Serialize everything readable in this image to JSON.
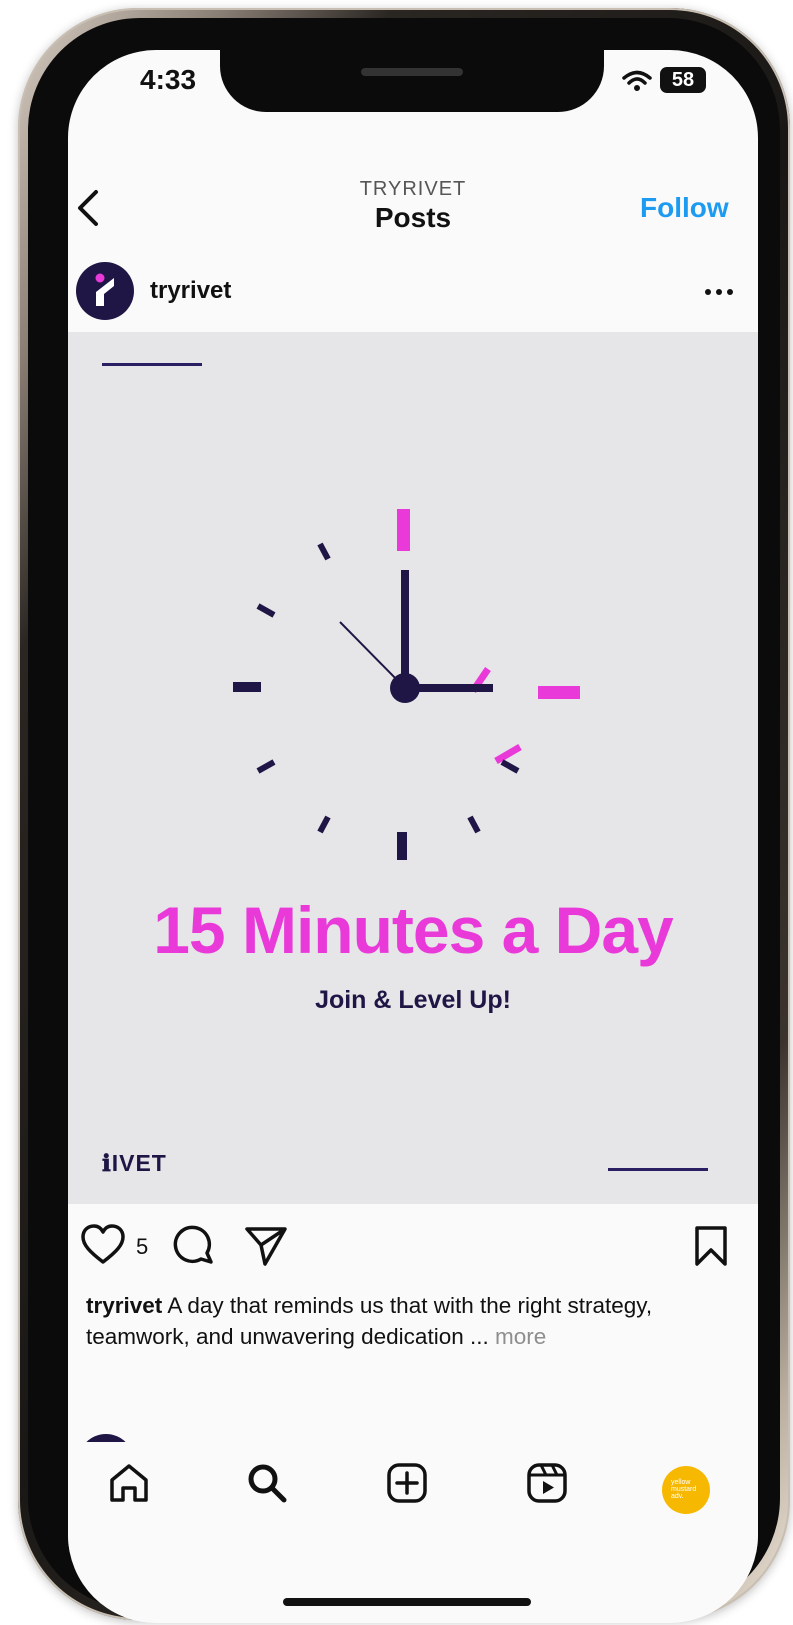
{
  "status": {
    "time": "4:33",
    "battery": "58"
  },
  "header": {
    "account": "TRYRIVET",
    "title": "Posts",
    "follow_label": "Follow"
  },
  "post": {
    "username": "tryrivet",
    "headline": "15 Minutes a Day",
    "subheadline": "Join & Level Up!",
    "brand": "ℹIVET",
    "likes": "5",
    "caption_user": "tryrivet",
    "caption_text": "A day that reminds us that with the right strategy, teamwork, and unwavering dedication ...",
    "caption_more": "more"
  },
  "tabbar": {
    "items": [
      "home-icon",
      "search-icon",
      "create-post-icon",
      "reels-icon",
      "profile-avatar"
    ],
    "profile_text": "yellow mustard adv."
  },
  "colors": {
    "accent_pink": "#e93ad9",
    "navy": "#1f1646",
    "link_blue": "#1d9bf0",
    "image_bg": "#e6e6e8"
  }
}
